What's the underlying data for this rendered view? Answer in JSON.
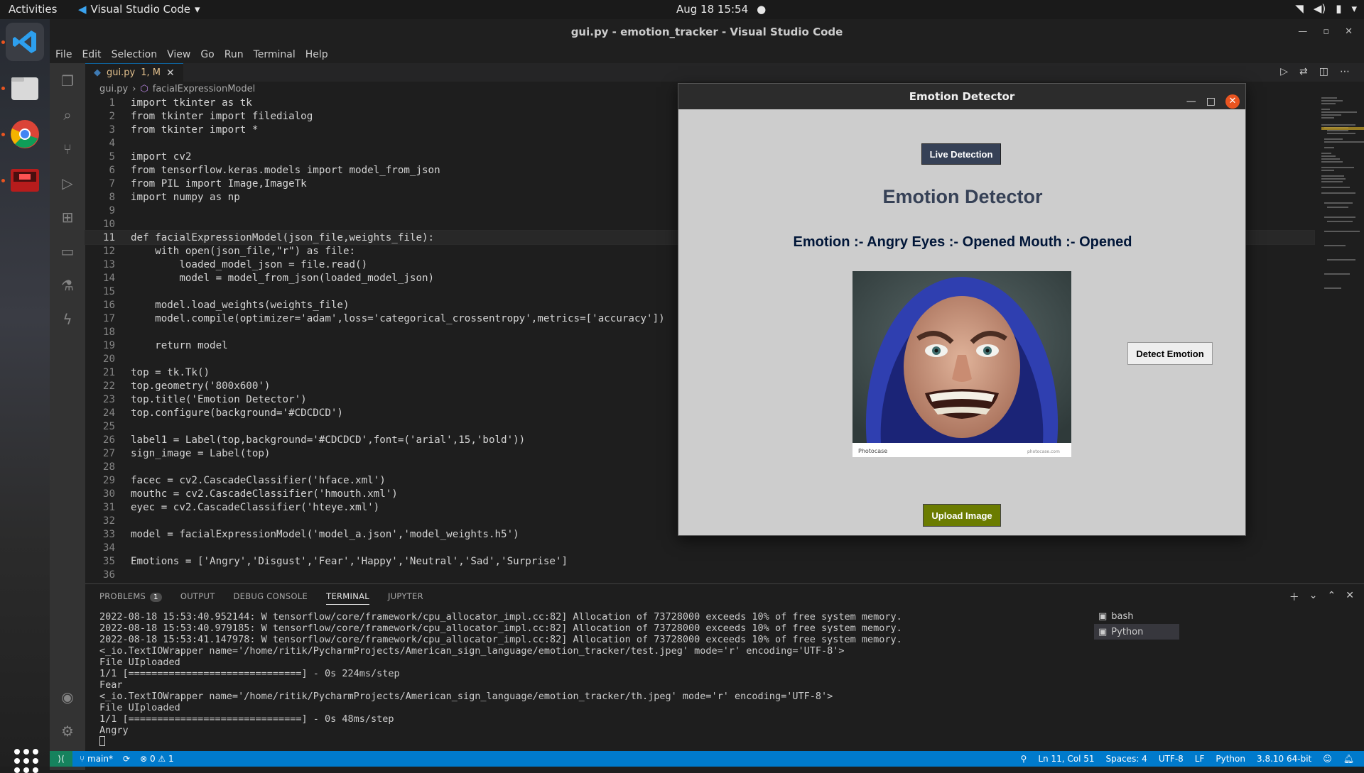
{
  "topbar": {
    "activities": "Activities",
    "app_name": "Visual Studio Code",
    "datetime": "Aug 18  15:54"
  },
  "window": {
    "title": "gui.py - emotion_tracker - Visual Studio Code"
  },
  "menu": [
    "File",
    "Edit",
    "Selection",
    "View",
    "Go",
    "Run",
    "Terminal",
    "Help"
  ],
  "tab": {
    "label": "gui.py",
    "status": "1, M"
  },
  "breadcrumb": {
    "file": "gui.py",
    "symbol": "facialExpressionModel"
  },
  "code_lines": [
    "import tkinter as tk",
    "from tkinter import filedialog",
    "from tkinter import *",
    "",
    "import cv2",
    "from tensorflow.keras.models import model_from_json",
    "from PIL import Image,ImageTk",
    "import numpy as np",
    "",
    "",
    "def facialExpressionModel(json_file,weights_file):",
    "    with open(json_file,\"r\") as file:",
    "        loaded_model_json = file.read()",
    "        model = model_from_json(loaded_model_json)",
    "",
    "    model.load_weights(weights_file)",
    "    model.compile(optimizer='adam',loss='categorical_crossentropy',metrics=['accuracy'])",
    "",
    "    return model",
    "",
    "top = tk.Tk()",
    "top.geometry('800x600')",
    "top.title('Emotion Detector')",
    "top.configure(background='#CDCDCD')",
    "",
    "label1 = Label(top,background='#CDCDCD',font=('arial',15,'bold'))",
    "sign_image = Label(top)",
    "",
    "facec = cv2.CascadeClassifier('hface.xml')",
    "mouthc = cv2.CascadeClassifier('hmouth.xml')",
    "eyec = cv2.CascadeClassifier('hteye.xml')",
    "",
    "model = facialExpressionModel('model_a.json','model_weights.h5')",
    "",
    "Emotions = ['Angry','Disgust','Fear','Happy','Neutral','Sad','Surprise']",
    ""
  ],
  "current_line": 11,
  "panel": {
    "tabs": [
      "PROBLEMS",
      "OUTPUT",
      "DEBUG CONSOLE",
      "TERMINAL",
      "JUPYTER"
    ],
    "active_tab": "TERMINAL",
    "problems_count": "1",
    "terminal_lines": [
      "2022-08-18 15:53:40.952144: W tensorflow/core/framework/cpu_allocator_impl.cc:82] Allocation of 73728000 exceeds 10% of free system memory.",
      "2022-08-18 15:53:40.979185: W tensorflow/core/framework/cpu_allocator_impl.cc:82] Allocation of 73728000 exceeds 10% of free system memory.",
      "2022-08-18 15:53:41.147978: W tensorflow/core/framework/cpu_allocator_impl.cc:82] Allocation of 73728000 exceeds 10% of free system memory.",
      "<_io.TextIOWrapper name='/home/ritik/PycharmProjects/American_sign_language/emotion_tracker/test.jpeg' mode='r' encoding='UTF-8'>",
      "File UIploaded",
      "1/1 [==============================] - 0s 224ms/step",
      "Fear",
      "<_io.TextIOWrapper name='/home/ritik/PycharmProjects/American_sign_language/emotion_tracker/th.jpeg' mode='r' encoding='UTF-8'>",
      "File UIploaded",
      "1/1 [==============================] - 0s 48ms/step",
      "Angry"
    ],
    "shells": [
      "bash",
      "Python"
    ]
  },
  "status": {
    "branch": "main*",
    "errors": "0",
    "warnings": "1",
    "position": "Ln 11, Col 51",
    "spaces": "Spaces: 4",
    "encoding": "UTF-8",
    "eol": "LF",
    "language": "Python",
    "interpreter": "3.8.10 64-bit"
  },
  "tk": {
    "title": "Emotion Detector",
    "live_button": "Live Detection",
    "heading": "Emotion Detector",
    "result": "Emotion :- Angry Eyes :- Opened Mouth :- Opened",
    "detect_button": "Detect Emotion",
    "upload_button": "Upload Image",
    "image_caption_left": "Photocase",
    "image_caption_right": "photocase.com"
  },
  "colors": {
    "accent": "#007acc",
    "tk_bg": "#CDCDCD",
    "live_btn": "#364156",
    "upload_btn": "#6b7c00"
  }
}
